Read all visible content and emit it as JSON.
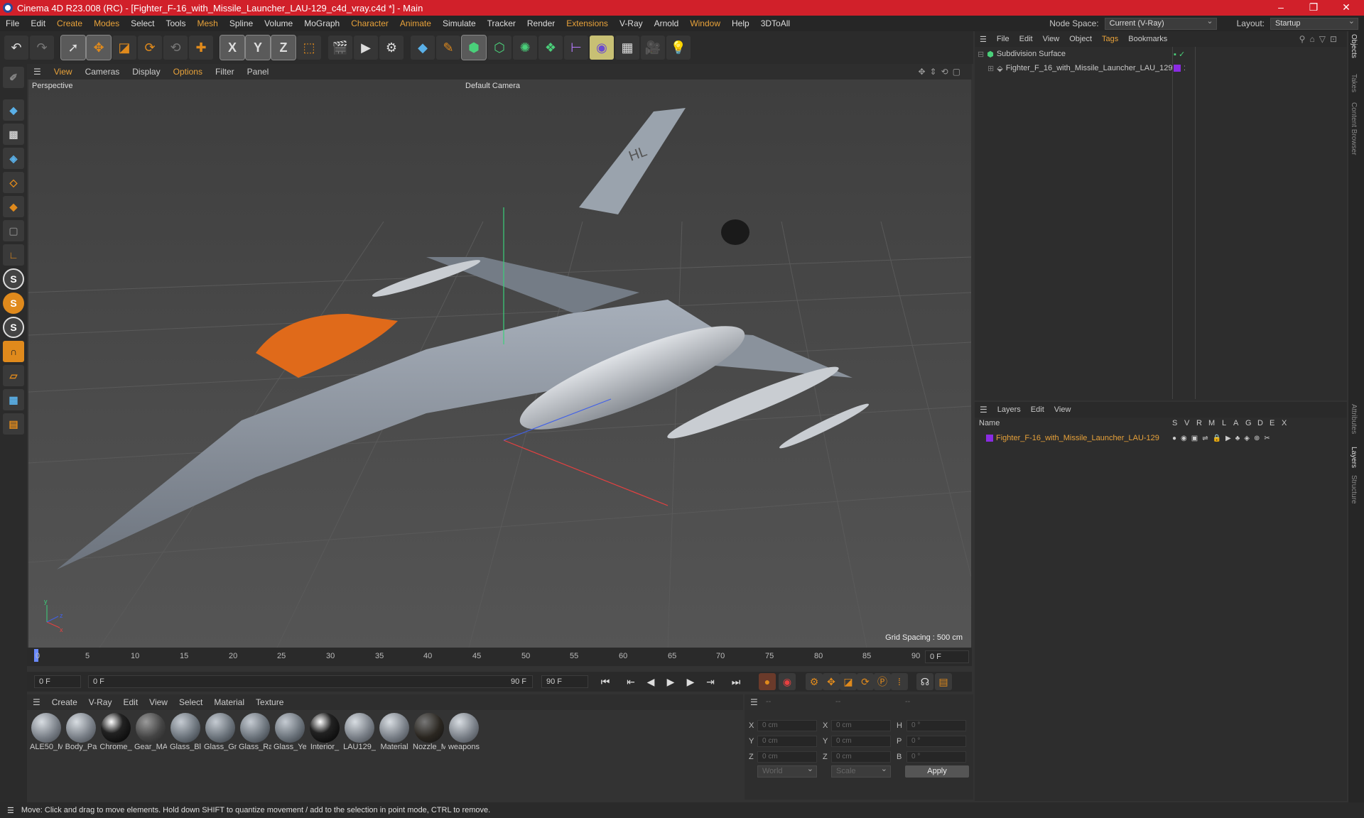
{
  "window": {
    "title": "Cinema 4D R23.008 (RC) - [Fighter_F-16_with_Missile_Launcher_LAU-129_c4d_vray.c4d *] - Main",
    "minimize": "–",
    "restore": "❐",
    "close": "✕"
  },
  "menu": [
    "File",
    "Edit",
    "Create",
    "Modes",
    "Select",
    "Tools",
    "Mesh",
    "Spline",
    "Volume",
    "MoGraph",
    "Character",
    "Animate",
    "Simulate",
    "Tracker",
    "Render",
    "Extensions",
    "V-Ray",
    "Arnold",
    "Window",
    "Help",
    "3DToAll"
  ],
  "nodespace": {
    "label": "Node Space:",
    "value": "Current (V-Ray)",
    "layout_label": "Layout:",
    "layout_value": "Startup"
  },
  "toolbar": {
    "x": "X",
    "y": "Y",
    "z": "Z"
  },
  "viewport": {
    "menu": [
      "View",
      "Cameras",
      "Display",
      "Options",
      "Filter",
      "Panel"
    ],
    "name": "Perspective",
    "camera": "Default Camera",
    "grid_spacing": "Grid Spacing : 500 cm",
    "model_marking": "HL"
  },
  "timeline": {
    "ticks": [
      "0",
      "5",
      "10",
      "15",
      "20",
      "25",
      "30",
      "35",
      "40",
      "45",
      "50",
      "55",
      "60",
      "65",
      "70",
      "75",
      "80",
      "85",
      "90"
    ],
    "current_frame": "0 F"
  },
  "playback": {
    "start": "0 F",
    "range_start": "0 F",
    "range_end": "90 F",
    "end": "90 F"
  },
  "materials": {
    "menu": [
      "Create",
      "V-Ray",
      "Edit",
      "View",
      "Select",
      "Material",
      "Texture"
    ],
    "items": [
      "ALE50_M",
      "Body_Pa",
      "Chrome_",
      "Gear_MA",
      "Glass_Bl",
      "Glass_Gr",
      "Glass_Ra",
      "Glass_Ye",
      "Interior_",
      "LAU129_",
      "Material",
      "Nozzle_M",
      "weapons"
    ]
  },
  "coords": {
    "header": [
      "--",
      "--",
      "--"
    ],
    "pos_labels": [
      "X",
      "Y",
      "Z"
    ],
    "size_labels": [
      "X",
      "Y",
      "Z"
    ],
    "rot_labels": [
      "H",
      "P",
      "B"
    ],
    "pos": [
      "0 cm",
      "0 cm",
      "0 cm"
    ],
    "size": [
      "0 cm",
      "0 cm",
      "0 cm"
    ],
    "rot": [
      "0 °",
      "0 °",
      "0 °"
    ],
    "mode": "World",
    "scale": "Scale",
    "apply": "Apply"
  },
  "objects": {
    "menu": [
      "File",
      "Edit",
      "View",
      "Object",
      "Tags",
      "Bookmarks"
    ],
    "root": "Subdivision Surface",
    "child": "Fighter_F_16_with_Missile_Launcher_LAU_129"
  },
  "layers": {
    "menu": [
      "Layers",
      "Edit",
      "View"
    ],
    "columns": [
      "Name",
      "S",
      "V",
      "R",
      "M",
      "L",
      "A",
      "G",
      "D",
      "E",
      "X"
    ],
    "row": "Fighter_F-16_with_Missile_Launcher_LAU-129"
  },
  "right_tabs": [
    "Objects",
    "Takes",
    "Content Browser",
    "Attributes",
    "Layers",
    "Structure"
  ],
  "status": "Move: Click and drag to move elements. Hold down SHIFT to quantize movement / add to the selection in point mode, CTRL to remove.",
  "colors": {
    "title_red": "#d1202a",
    "accent_orange": "#e8a23a",
    "layer_purple": "#8a2be2"
  }
}
